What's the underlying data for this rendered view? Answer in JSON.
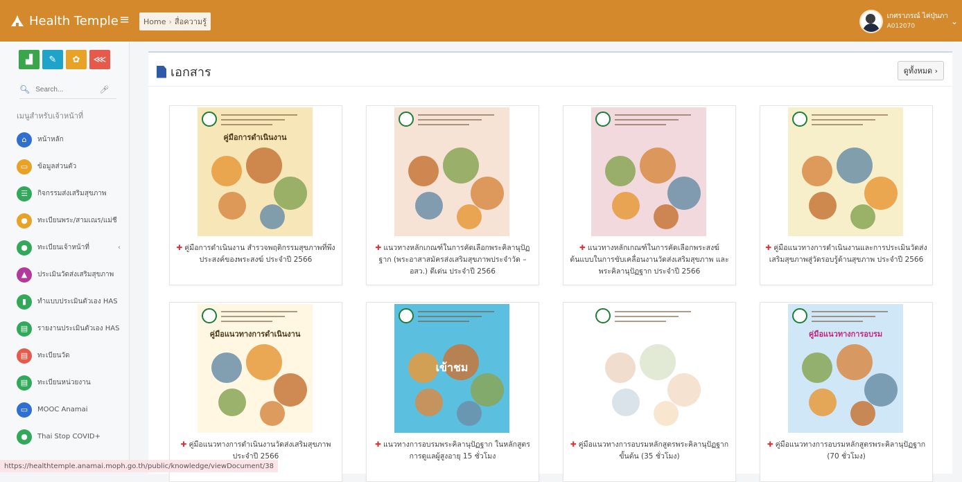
{
  "app": {
    "title": "Health Temple"
  },
  "breadcrumb": {
    "home": "Home",
    "separator": "›",
    "current": "สื่อความรู้"
  },
  "user": {
    "name": "เกศราภรณ์ ไค่ปุ่นภา",
    "id": "A012070"
  },
  "quick_buttons": [
    {
      "icon": "bar-chart-icon",
      "color": "#3aa64c"
    },
    {
      "icon": "edit-icon",
      "color": "#1fa3c9"
    },
    {
      "icon": "lotus-icon",
      "color": "#e8a226"
    },
    {
      "icon": "share-icon",
      "color": "#e55a4a"
    }
  ],
  "search": {
    "placeholder": "Search..."
  },
  "sidebar": {
    "heading": "เมนูสำหรับเจ้าหน้าที่",
    "items": [
      {
        "label": "หน้าหลัก",
        "icon": "home-icon",
        "color": "#2e6fd0"
      },
      {
        "label": "ข้อมูลส่วนตัว",
        "icon": "id-card-icon",
        "color": "#e8a226"
      },
      {
        "label": "กิจกรรมส่งเสริมสุขภาพ",
        "icon": "list-icon",
        "color": "#32a85a"
      },
      {
        "label": "ทะเบียนพระ/สามเณร/แม่ชี",
        "icon": "monk-icon",
        "color": "#e8a226"
      },
      {
        "label": "ทะเบียนเจ้าหน้าที่",
        "icon": "users-icon",
        "color": "#32a85a"
      },
      {
        "label": "ประเมินวัดส่งเสริมสุขภาพ",
        "icon": "temple-icon",
        "color": "#b23a9a"
      },
      {
        "label": "ทำแบบประเมินตัวเอง HAS",
        "icon": "doc-icon",
        "color": "#32a85a"
      },
      {
        "label": "รายงานประเมินตัวเอง HAS",
        "icon": "db-icon",
        "color": "#32a85a"
      },
      {
        "label": "ทะเบียนวัด",
        "icon": "db-icon",
        "color": "#e55a4a"
      },
      {
        "label": "ทะเบียนหน่วยงาน",
        "icon": "db-icon",
        "color": "#32a85a"
      },
      {
        "label": "MOOC Anamai",
        "icon": "mooc-icon",
        "color": "#2e6fd0"
      },
      {
        "label": "Thai Stop COVID+",
        "icon": "user-icon",
        "color": "#32a85a"
      }
    ]
  },
  "main": {
    "title": "เอกสาร",
    "view_all": "ดูทั้งหมด ›"
  },
  "documents": [
    {
      "caption": "คู่มือการดำเนินงาน สำรวจพฤติกรรมสุขภาพที่พึงประสงค์ของพระสงฆ์ ประจำปี 2566",
      "cover_bg": "#f6e6b8",
      "cover_title": "คู่มือการดำเนินงาน"
    },
    {
      "caption": "แนวทางหลักเกณฑ์ในการคัดเลือกพระคิลานุปัฏฐาก (พระอาสาสมัครส่งเสริมสุขภาพประจำวัด – อสว.) ดีเด่น ประจำปี 2566",
      "cover_bg": "#f6e3d6",
      "cover_title": ""
    },
    {
      "caption": "แนวทางหลักเกณฑ์ในการคัดเลือกพระสงฆ์ต้นแบบในการขับเคลื่อนงานวัดส่งเสริมสุขภาพ และพระคิลานุปัฏฐาก ประจำปี 2566",
      "cover_bg": "#f1d9de",
      "cover_title": ""
    },
    {
      "caption": "คู่มือแนวทางการดำเนินงานและการประเมินวัดส่งเสริมสุขภาพสู่วัดรอบรู้ด้านสุขภาพ ประจำปี 2566",
      "cover_bg": "#f7efc9",
      "cover_title": ""
    },
    {
      "caption": "คู่มือแนวทางการดำเนินงานวัดส่งเสริมสุขภาพ ประจำปี 2566",
      "cover_bg": "#fff7e2",
      "cover_title": "คู่มือแนวทางการดำเนินงาน"
    },
    {
      "caption": "แนวทางการอบรมพระคิลานุปัฏฐาก ในหลักสูตรการดูแลผู้สูงอายุ 15 ชั่วโมง",
      "cover_bg": "#5bbfe0",
      "cover_title": "เข้าชม"
    },
    {
      "caption": "คู่มือแนวทางการอบรมหลักสูตรพระคิลานุปัฏฐากขั้นต้น (35 ชั่วโมง)",
      "cover_bg": "#ffffff",
      "cover_title": ""
    },
    {
      "caption": "คู่มือแนวทางการอบรมหลักสูตรพระคิลานุปัฏฐาก (70 ชั่วโมง)",
      "cover_bg": "#cfe7f6",
      "cover_title": "คู่มือแนวทางการอบรม"
    }
  ],
  "status_bar": {
    "url": "https://healthtemple.anamai.moph.go.th/public/knowledge/viewDocument/38"
  }
}
